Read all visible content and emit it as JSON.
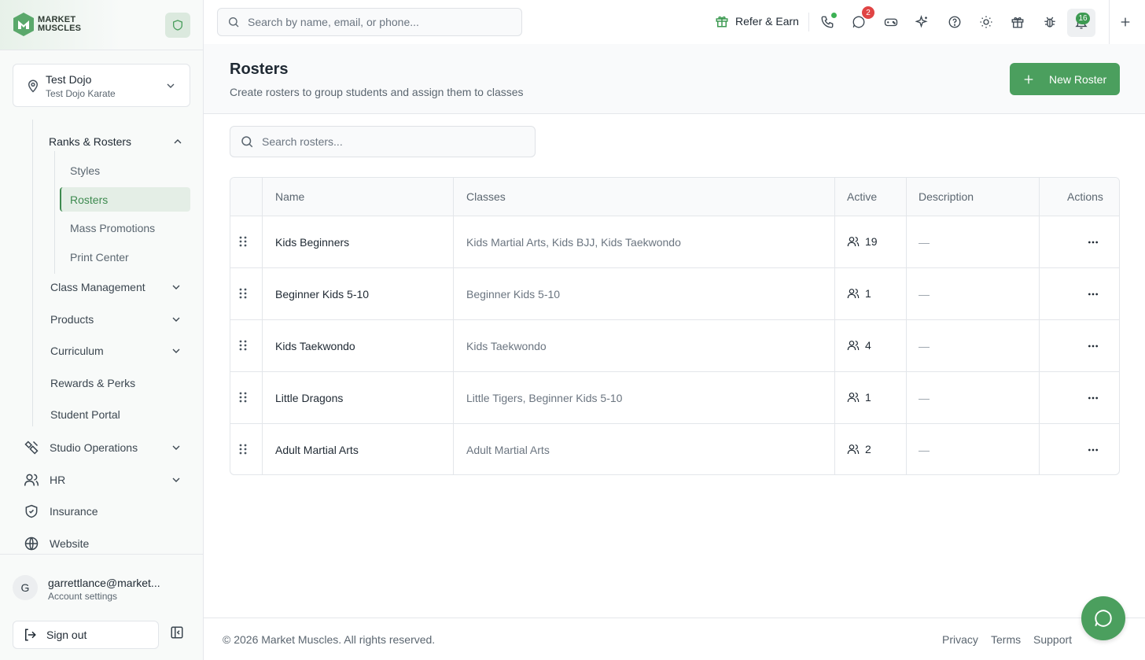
{
  "brand": {
    "logo_line1": "MARKET",
    "logo_line2": "MUSCLES"
  },
  "location": {
    "name": "Test Dojo",
    "sub": "Test Dojo Karate"
  },
  "sidebar": {
    "group_ranks": "Ranks & Rosters",
    "ranks_children": [
      "Styles",
      "Rosters",
      "Mass Promotions",
      "Print Center"
    ],
    "class_management": "Class Management",
    "products": "Products",
    "curriculum": "Curriculum",
    "rewards": "Rewards & Perks",
    "student_portal": "Student Portal",
    "studio_operations": "Studio Operations",
    "hr": "HR",
    "insurance": "Insurance",
    "website": "Website"
  },
  "user": {
    "initial": "G",
    "email": "garrettlance@market...",
    "sub": "Account settings",
    "signout": "Sign out"
  },
  "topbar": {
    "search_placeholder": "Search by name, email, or phone...",
    "refer": "Refer & Earn",
    "messages_badge": "2",
    "notifications_badge": "16"
  },
  "page": {
    "title": "Rosters",
    "subtitle": "Create rosters to group students and assign them to classes",
    "new_button": "New Roster",
    "search_placeholder": "Search rosters..."
  },
  "table": {
    "headers": {
      "name": "Name",
      "classes": "Classes",
      "active": "Active",
      "description": "Description",
      "actions": "Actions"
    },
    "rows": [
      {
        "name": "Kids Beginners",
        "classes": "Kids Martial Arts, Kids BJJ, Kids Taekwondo",
        "active": "19",
        "description": "—"
      },
      {
        "name": "Beginner Kids 5-10",
        "classes": "Beginner Kids 5-10",
        "active": "1",
        "description": "—"
      },
      {
        "name": "Kids Taekwondo",
        "classes": "Kids Taekwondo",
        "active": "4",
        "description": "—"
      },
      {
        "name": "Little Dragons",
        "classes": "Little Tigers, Beginner Kids 5-10",
        "active": "1",
        "description": "—"
      },
      {
        "name": "Adult Martial Arts",
        "classes": "Adult Martial Arts",
        "active": "2",
        "description": "—"
      }
    ]
  },
  "footer": {
    "copyright": "© 2026 Market Muscles. All rights reserved.",
    "privacy": "Privacy",
    "terms": "Terms",
    "support": "Support"
  },
  "colors": {
    "accent": "#4b9f5e",
    "badge_red": "#e04444",
    "active_nav": "#3d8a4f"
  }
}
